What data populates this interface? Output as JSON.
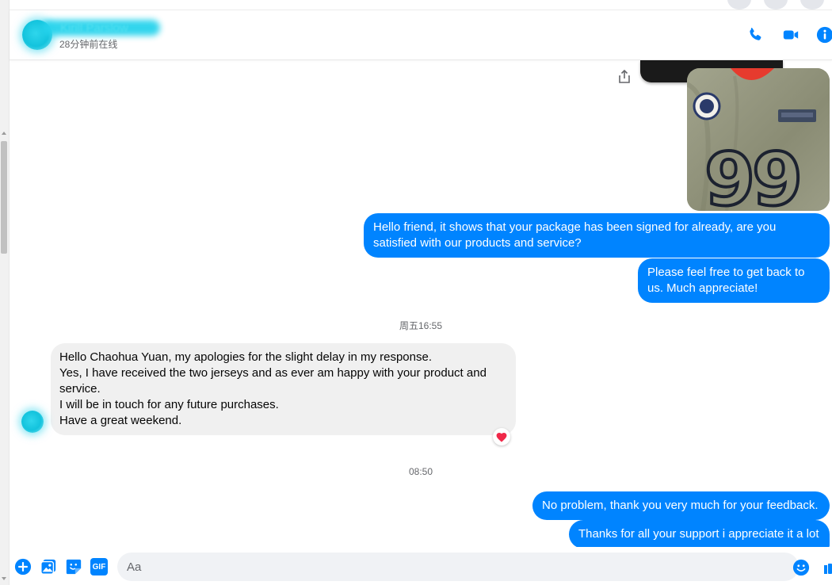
{
  "header": {
    "contact_name": "Kirill Parslow",
    "status": "28分钟前在线"
  },
  "messages": [
    {
      "id": "m1",
      "direction": "outgoing",
      "text": "Hello friend, it shows that your package has been signed for already, are you satisfied with our products and service?"
    },
    {
      "id": "m2",
      "direction": "outgoing",
      "text": "Please feel free to get back to us. Much appreciate!"
    },
    {
      "id": "t1",
      "type": "timestamp",
      "text": "周五16:55"
    },
    {
      "id": "m3",
      "direction": "incoming",
      "lines": [
        "Hello Chaohua Yuan, my apologies for the slight delay in my response.",
        "Yes, I have received the two jerseys and as ever am happy with your product and service.",
        "I will be in touch for any future purchases.",
        "Have a great weekend."
      ],
      "reaction": "heart"
    },
    {
      "id": "t2",
      "type": "timestamp",
      "text": "08:50"
    },
    {
      "id": "m4",
      "direction": "outgoing",
      "text": "No problem, thank you very much for your feedback."
    },
    {
      "id": "m5",
      "direction": "outgoing",
      "text": "Thanks for all your support i appreciate it a lot"
    }
  ],
  "photo": {
    "jersey_number": "99"
  },
  "composer": {
    "placeholder": "Aa",
    "gif_label": "GIF"
  },
  "colors": {
    "accent": "#0084ff",
    "incoming_bubble": "#f0f0f0",
    "reaction": "#f02849"
  }
}
